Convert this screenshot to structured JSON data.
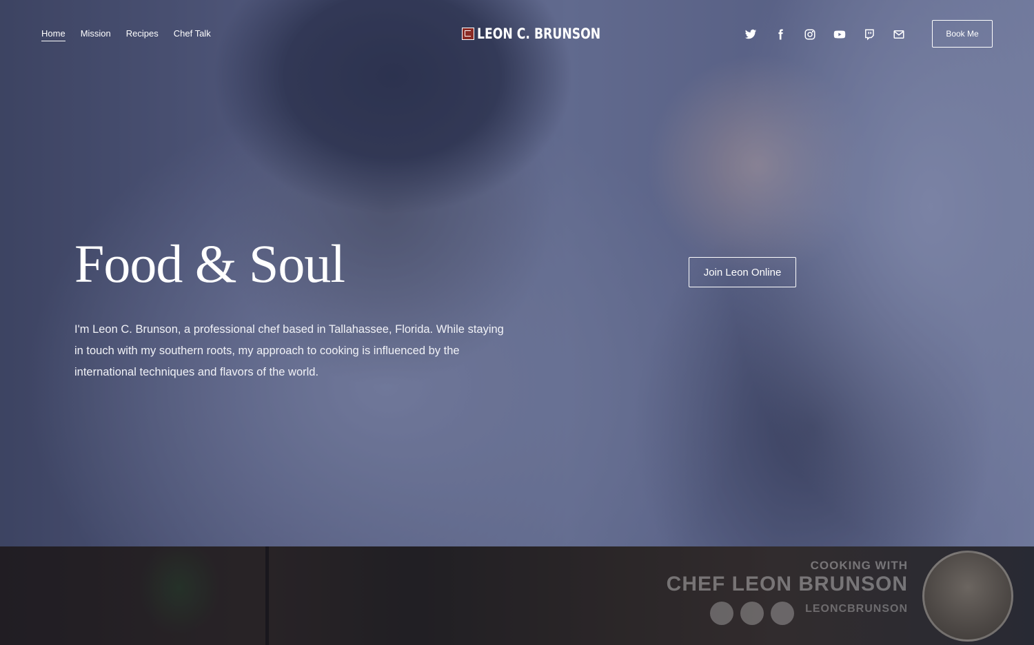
{
  "nav": {
    "items": [
      {
        "label": "Home",
        "active": true
      },
      {
        "label": "Mission",
        "active": false
      },
      {
        "label": "Recipes",
        "active": false
      },
      {
        "label": "Chef Talk",
        "active": false
      }
    ]
  },
  "logo": {
    "text": "LEON C. BRUNSON",
    "mark_color": "#8b2b25"
  },
  "socials": [
    "twitter-icon",
    "facebook-icon",
    "instagram-icon",
    "youtube-icon",
    "twitch-icon",
    "email-icon"
  ],
  "header": {
    "book_label": "Book Me"
  },
  "hero": {
    "title": "Food & Soul",
    "description": "I'm Leon C. Brunson, a professional chef based in Tallahassee, Florida. While staying in touch with my southern roots, my approach to cooking is influenced by the international techniques and flavors of the world.",
    "cta_label": "Join Leon Online",
    "overlay_color": "#3a4268"
  },
  "next_section": {
    "line1": "COOKING WITH",
    "line2": "CHEF LEON BRUNSON",
    "line3": "LEONCBRUNSON"
  }
}
